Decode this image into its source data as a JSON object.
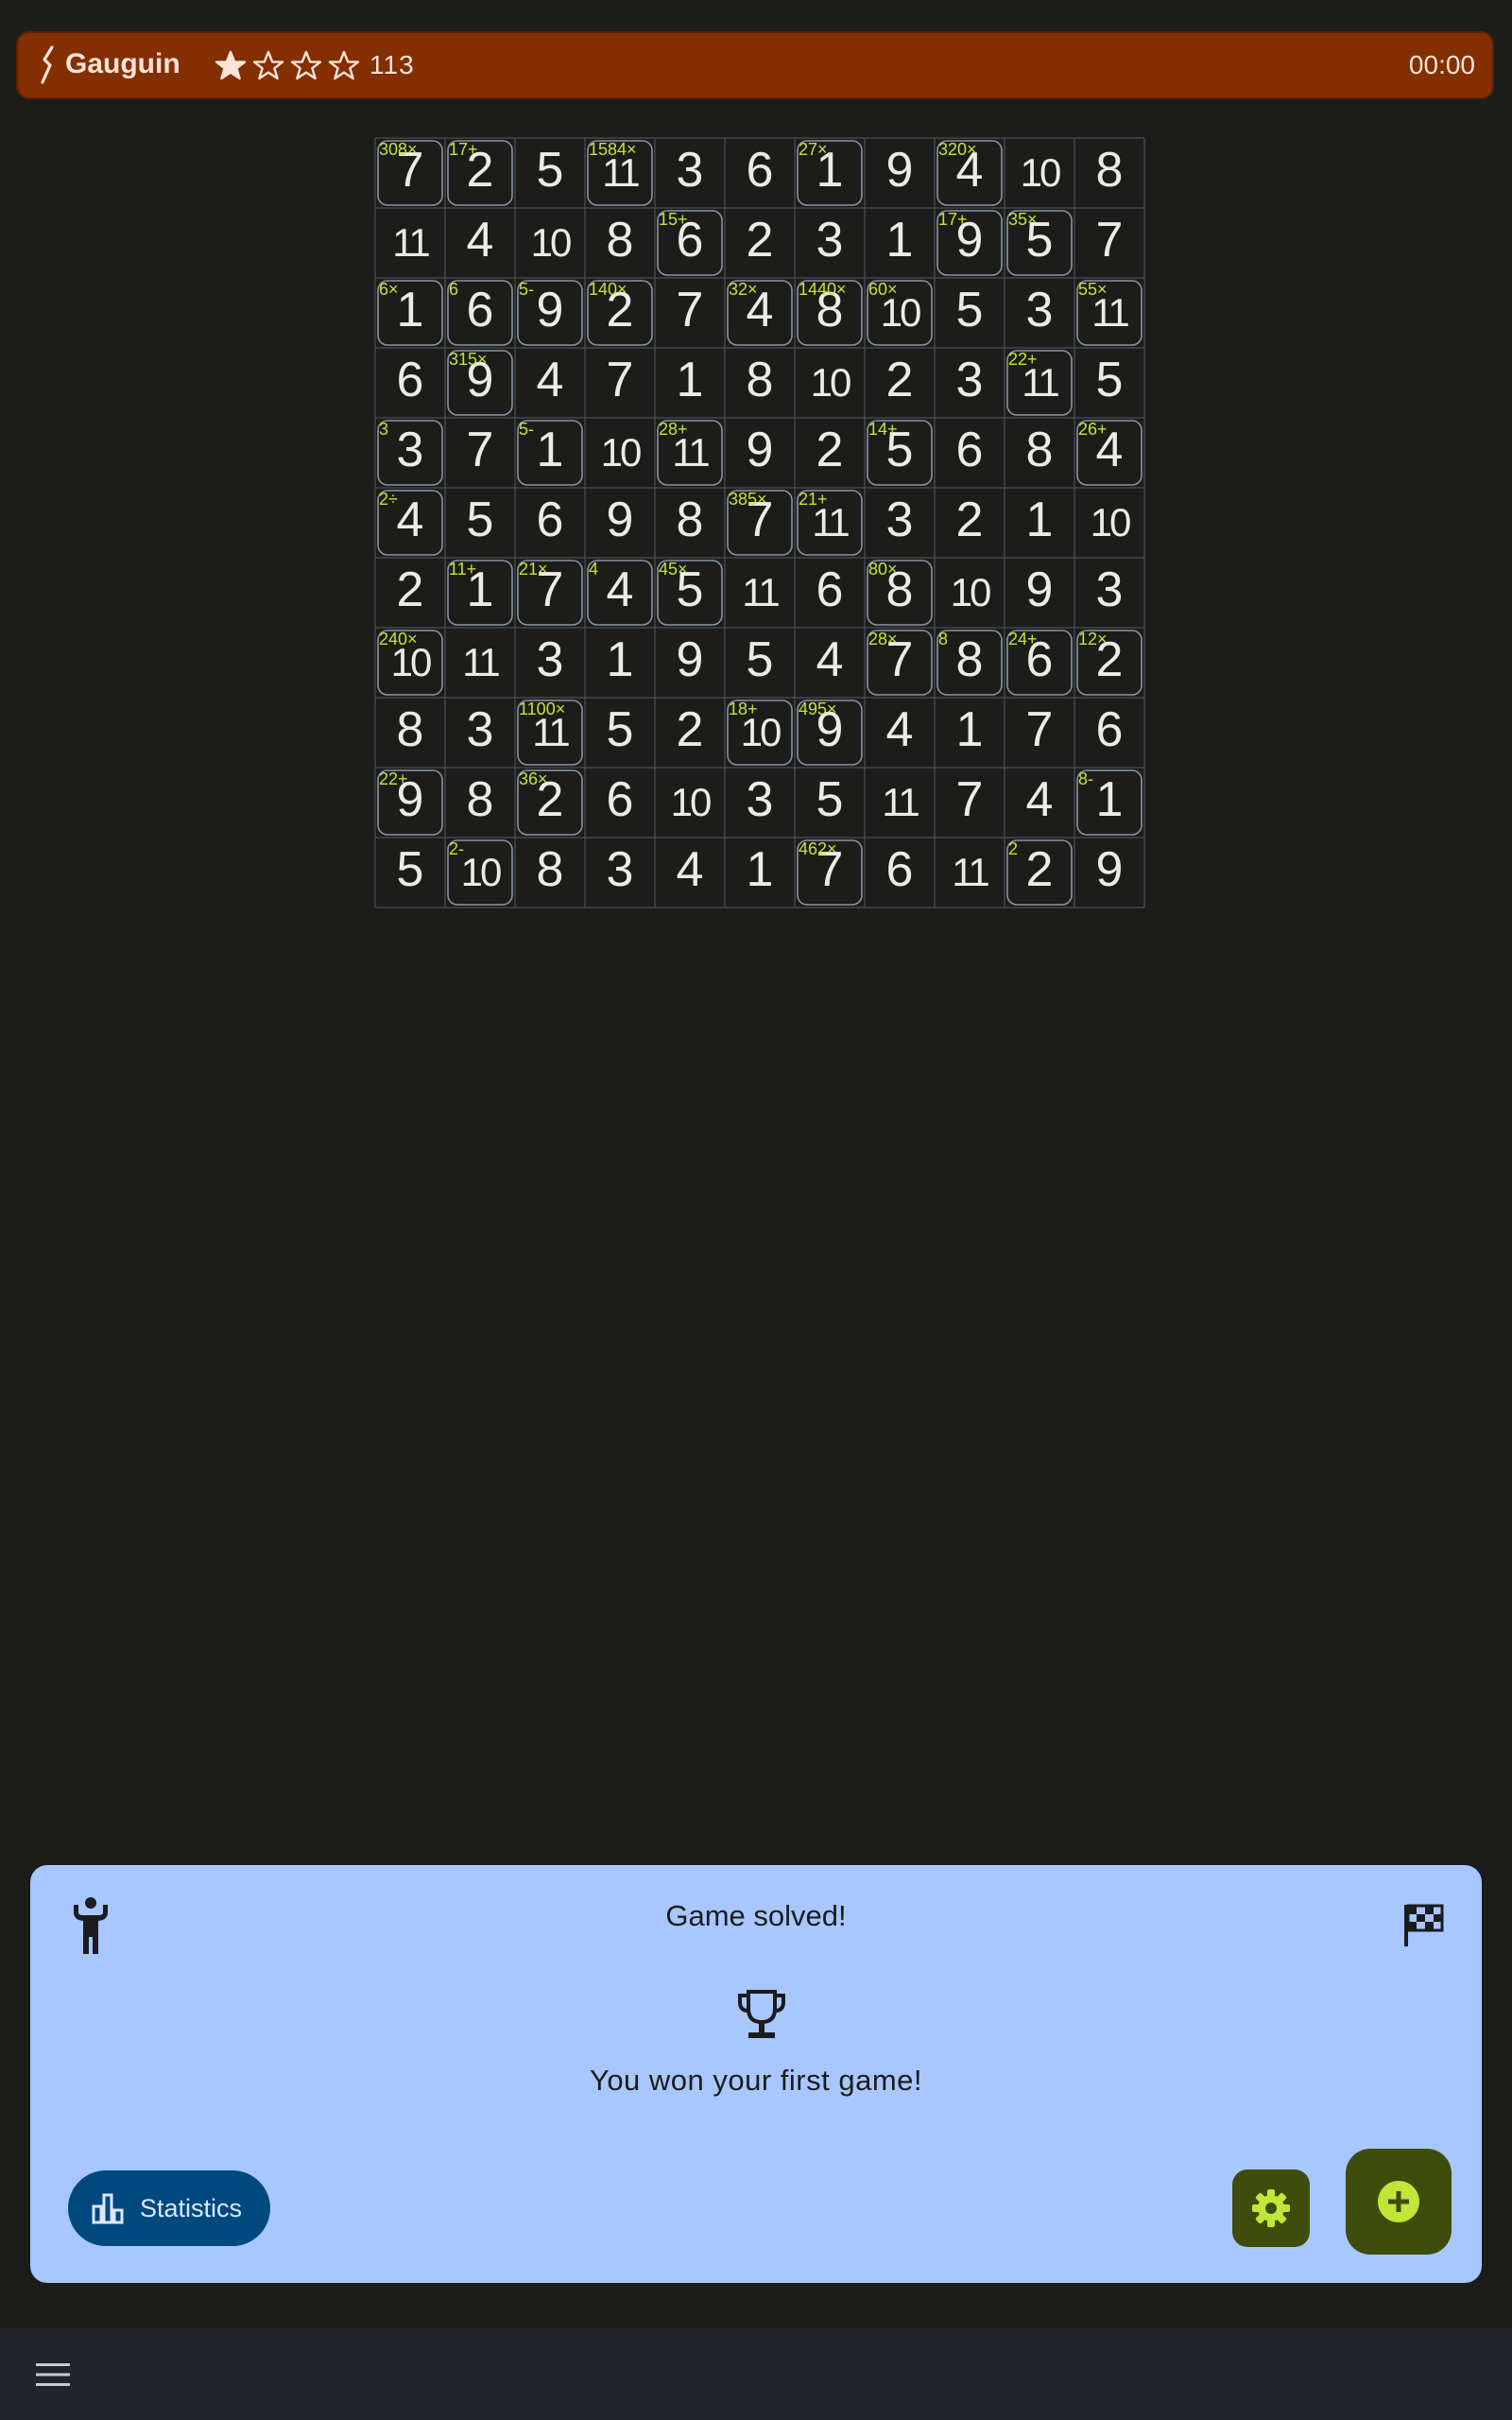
{
  "header": {
    "title": "Gauguin",
    "rating": {
      "filled": 1,
      "total": 4
    },
    "puzzle_number": "113",
    "timer": "00:00"
  },
  "icons": {
    "logo": "gauguin-logo-icon",
    "star_filled": "star-filled-icon",
    "star_outline": "star-outline-icon",
    "person": "person-celebrate-icon",
    "flag": "checkered-flag-icon",
    "trophy": "trophy-icon",
    "stats": "bar-chart-icon",
    "settings": "gear-icon",
    "new_game": "add-circle-icon",
    "menu": "hamburger-menu-icon"
  },
  "colors": {
    "header_bg": "#842f00",
    "clue_color": "#c2e638",
    "panel_bg": "#a9c7ff",
    "stats_button_bg": "#00497f",
    "accent_dark": "#3f4d0c",
    "accent_light": "#c2e638",
    "page_bg": "#1c1d1a"
  },
  "board": {
    "size": 11,
    "values": [
      [
        7,
        2,
        5,
        11,
        3,
        6,
        1,
        9,
        4,
        10,
        8
      ],
      [
        11,
        4,
        10,
        8,
        6,
        2,
        3,
        1,
        9,
        5,
        7
      ],
      [
        1,
        6,
        9,
        2,
        7,
        4,
        8,
        10,
        5,
        3,
        11
      ],
      [
        6,
        9,
        4,
        7,
        1,
        8,
        10,
        2,
        3,
        11,
        5
      ],
      [
        3,
        7,
        1,
        10,
        11,
        9,
        2,
        5,
        6,
        8,
        4
      ],
      [
        4,
        5,
        6,
        9,
        8,
        7,
        11,
        3,
        2,
        1,
        10
      ],
      [
        2,
        1,
        7,
        4,
        5,
        11,
        6,
        8,
        10,
        9,
        3
      ],
      [
        10,
        11,
        3,
        1,
        9,
        5,
        4,
        7,
        8,
        6,
        2
      ],
      [
        8,
        3,
        11,
        5,
        2,
        10,
        9,
        4,
        1,
        7,
        6
      ],
      [
        9,
        8,
        2,
        6,
        10,
        3,
        5,
        11,
        7,
        4,
        1
      ],
      [
        5,
        10,
        8,
        3,
        4,
        1,
        7,
        6,
        11,
        2,
        9
      ]
    ],
    "clues": [
      {
        "row": 0,
        "col": 0,
        "text": "308×"
      },
      {
        "row": 0,
        "col": 1,
        "text": "17+"
      },
      {
        "row": 0,
        "col": 3,
        "text": "1584×"
      },
      {
        "row": 0,
        "col": 6,
        "text": "27×"
      },
      {
        "row": 0,
        "col": 8,
        "text": "320×"
      },
      {
        "row": 1,
        "col": 4,
        "text": "15+"
      },
      {
        "row": 1,
        "col": 8,
        "text": "17+"
      },
      {
        "row": 1,
        "col": 9,
        "text": "35×"
      },
      {
        "row": 2,
        "col": 0,
        "text": "6×"
      },
      {
        "row": 2,
        "col": 1,
        "text": "6"
      },
      {
        "row": 2,
        "col": 2,
        "text": "5-"
      },
      {
        "row": 2,
        "col": 3,
        "text": "140×"
      },
      {
        "row": 2,
        "col": 5,
        "text": "32×"
      },
      {
        "row": 2,
        "col": 6,
        "text": "1440×"
      },
      {
        "row": 2,
        "col": 7,
        "text": "60×"
      },
      {
        "row": 2,
        "col": 10,
        "text": "55×"
      },
      {
        "row": 3,
        "col": 1,
        "text": "315×"
      },
      {
        "row": 3,
        "col": 9,
        "text": "22+"
      },
      {
        "row": 4,
        "col": 0,
        "text": "3"
      },
      {
        "row": 4,
        "col": 2,
        "text": "5-"
      },
      {
        "row": 4,
        "col": 4,
        "text": "28+"
      },
      {
        "row": 4,
        "col": 7,
        "text": "14+"
      },
      {
        "row": 4,
        "col": 10,
        "text": "26+"
      },
      {
        "row": 5,
        "col": 0,
        "text": "2÷"
      },
      {
        "row": 5,
        "col": 5,
        "text": "385×"
      },
      {
        "row": 5,
        "col": 6,
        "text": "21+"
      },
      {
        "row": 6,
        "col": 1,
        "text": "11+"
      },
      {
        "row": 6,
        "col": 2,
        "text": "21×"
      },
      {
        "row": 6,
        "col": 3,
        "text": "4"
      },
      {
        "row": 6,
        "col": 4,
        "text": "45×"
      },
      {
        "row": 6,
        "col": 7,
        "text": "80×"
      },
      {
        "row": 7,
        "col": 0,
        "text": "240×"
      },
      {
        "row": 7,
        "col": 7,
        "text": "28×"
      },
      {
        "row": 7,
        "col": 8,
        "text": "8"
      },
      {
        "row": 7,
        "col": 9,
        "text": "24+"
      },
      {
        "row": 7,
        "col": 10,
        "text": "12×"
      },
      {
        "row": 8,
        "col": 2,
        "text": "1100×"
      },
      {
        "row": 8,
        "col": 5,
        "text": "18+"
      },
      {
        "row": 8,
        "col": 6,
        "text": "495×"
      },
      {
        "row": 9,
        "col": 0,
        "text": "22+"
      },
      {
        "row": 9,
        "col": 2,
        "text": "36×"
      },
      {
        "row": 9,
        "col": 10,
        "text": "8-"
      },
      {
        "row": 10,
        "col": 1,
        "text": "2-"
      },
      {
        "row": 10,
        "col": 6,
        "text": "462×"
      },
      {
        "row": 10,
        "col": 9,
        "text": "2"
      }
    ]
  },
  "result_panel": {
    "title": "Game solved!",
    "message": "You won your first game!",
    "statistics_label": "Statistics"
  }
}
